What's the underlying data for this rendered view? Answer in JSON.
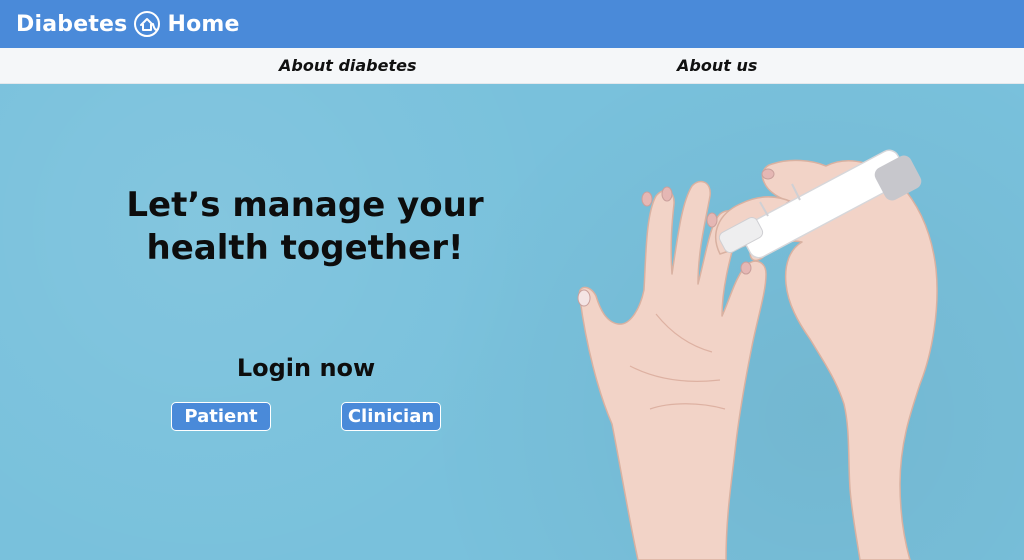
{
  "brand": {
    "left_word": "Diabetes",
    "symbol": "@",
    "right_word": "Home"
  },
  "nav": {
    "items": [
      {
        "label": "About diabetes"
      },
      {
        "label": "About us"
      }
    ]
  },
  "hero": {
    "headline_line1": "Let’s manage your",
    "headline_line2": "health together!",
    "login_title": "Login now",
    "buttons": {
      "patient": "Patient",
      "clinician": "Clinician"
    },
    "image_alt_subject": "hands-with-lancet-pen"
  },
  "colors": {
    "header_bg": "#4a8ad9",
    "nav_bg": "#f5f7f9",
    "hero_bg": "#79c1dc",
    "button_bg": "#4a8ad9",
    "text_dark": "#0d0d0d"
  }
}
